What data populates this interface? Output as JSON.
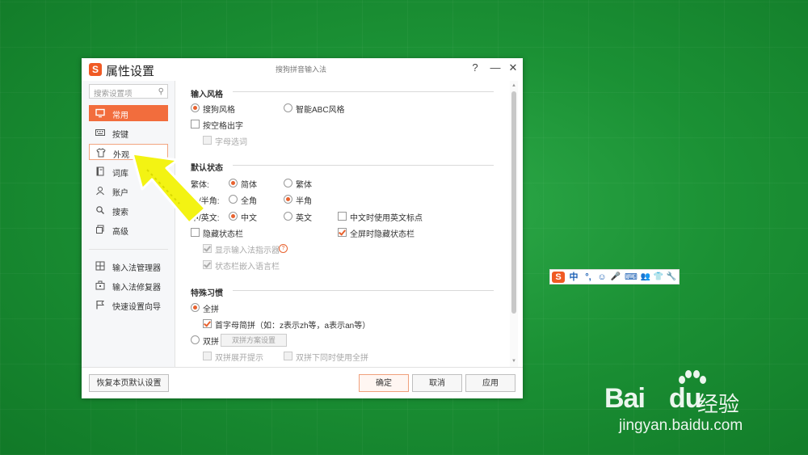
{
  "window": {
    "logo_letter": "S",
    "title": "属性设置",
    "center_title": "搜狗拼音输入法",
    "help": "?",
    "minimize": "—",
    "close": "✕"
  },
  "sidebar": {
    "search_placeholder": "搜索设置项",
    "items": [
      {
        "label": "常用",
        "icon": "monitor-icon"
      },
      {
        "label": "按键",
        "icon": "keyboard-icon"
      },
      {
        "label": "外观",
        "icon": "tshirt-icon"
      },
      {
        "label": "词库",
        "icon": "book-icon"
      },
      {
        "label": "账户",
        "icon": "user-icon"
      },
      {
        "label": "搜索",
        "icon": "search-icon"
      },
      {
        "label": "高级",
        "icon": "layers-icon"
      }
    ],
    "tools": [
      {
        "label": "输入法管理器",
        "icon": "grid-icon"
      },
      {
        "label": "输入法修复器",
        "icon": "toolbox-icon"
      },
      {
        "label": "快速设置向导",
        "icon": "flag-icon"
      }
    ]
  },
  "input_style": {
    "heading": "输入风格",
    "sogou": "搜狗风格",
    "abc": "智能ABC风格",
    "space_output": "按空格出字",
    "letter_select": "字母选词"
  },
  "default_state": {
    "heading": "默认状态",
    "trad_label": "繁体:",
    "simplified": "简体",
    "traditional": "繁体",
    "width_label": "全/半角:",
    "full": "全角",
    "half": "半角",
    "lang_label": "中/英文:",
    "chinese": "中文",
    "english": "英文",
    "en_punct": "中文时使用英文标点",
    "hide_status": "隐藏状态栏",
    "fullscreen_hide": "全屏时隐藏状态栏",
    "show_indicator": "显示输入法指示器",
    "embed_lang": "状态栏嵌入语言栏"
  },
  "special": {
    "heading": "特殊习惯",
    "quanpin": "全拼",
    "initials": "首字母简拼（如：z表示zh等，a表示an等）",
    "shuangpin": "双拼",
    "scheme_btn": "双拼方案设置",
    "expand_hint": "双拼展开提示",
    "also_quanpin": "双拼下同时使用全拼"
  },
  "footer": {
    "restore": "恢复本页默认设置",
    "ok": "确定",
    "cancel": "取消",
    "apply": "应用"
  },
  "tray": {
    "logo": "S",
    "lang": "中",
    "punct": "°,",
    "items": [
      "☺",
      "🎤",
      "⌨",
      "👥",
      "👕",
      "🔧"
    ]
  },
  "watermark": {
    "brand": "Bai",
    "brand2": "du",
    "jingyan": "经验",
    "url": "jingyan.baidu.com"
  }
}
